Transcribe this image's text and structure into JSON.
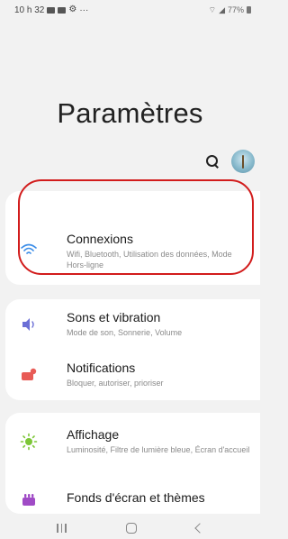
{
  "status_bar": {
    "time": "10 h 32",
    "more": "···",
    "battery": "77%"
  },
  "header": {
    "title": "Paramètres"
  },
  "cards": [
    {
      "items": [
        {
          "title": "Connexions",
          "subtitle": "Wifi, Bluetooth, Utilisation des données, Mode Hors-ligne",
          "icon": "wifi-icon",
          "icon_color": "#3d8ee8"
        }
      ]
    },
    {
      "items": [
        {
          "title": "Sons et vibration",
          "subtitle": "Mode de son, Sonnerie, Volume",
          "icon": "speaker-icon",
          "icon_color": "#6b6fd6"
        },
        {
          "title": "Notifications",
          "subtitle": "Bloquer, autoriser, prioriser",
          "icon": "notifications-icon",
          "icon_color": "#e85b56"
        }
      ]
    },
    {
      "items": [
        {
          "title": "Affichage",
          "subtitle": "Luminosité, Filtre de lumière bleue, Écran d'accueil",
          "icon": "brightness-icon",
          "icon_color": "#7cc637"
        },
        {
          "title": "Fonds d'écran et thèmes",
          "subtitle": "",
          "icon": "wallpaper-icon",
          "icon_color": "#a04bc6"
        }
      ]
    }
  ],
  "annotation": {
    "color": "#d21c1c"
  },
  "nav_bar": {
    "buttons": [
      "recents-icon",
      "home-icon",
      "back-icon"
    ]
  }
}
